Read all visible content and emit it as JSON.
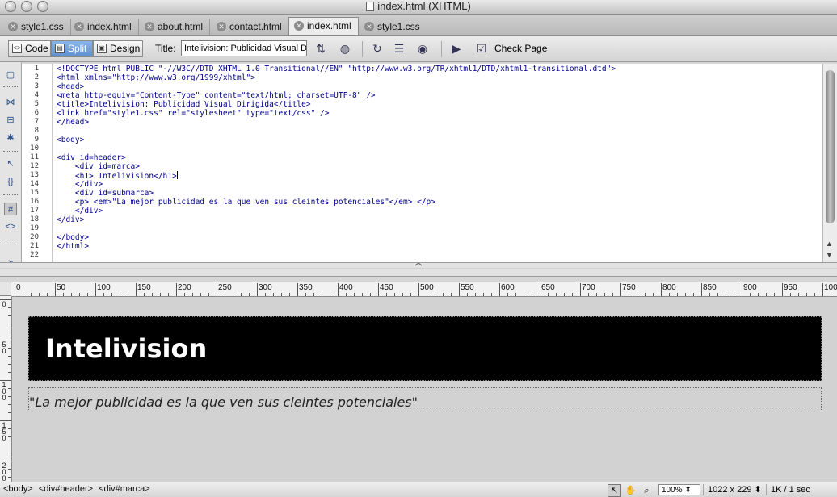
{
  "window": {
    "title": "index.html (XHTML)"
  },
  "tabs": [
    {
      "label": "style1.css"
    },
    {
      "label": "index.html"
    },
    {
      "label": "about.html"
    },
    {
      "label": "contact.html"
    },
    {
      "label": "index.html"
    },
    {
      "label": "style1.css"
    }
  ],
  "active_tab": 4,
  "toolbar": {
    "code_label": "Code",
    "split_label": "Split",
    "design_label": "Design",
    "title_label": "Title:",
    "title_value": "Intelivision: Publicidad Visual D",
    "check_page_label": "Check Page"
  },
  "code": {
    "line_numbers": [
      "1",
      "2",
      "3",
      "4",
      "5",
      "6",
      "7",
      "8",
      "9",
      "10",
      "11",
      "12",
      "13",
      "14",
      "15",
      "16",
      "17",
      "18",
      "19",
      "20",
      "21",
      "22"
    ],
    "lines": [
      "<!DOCTYPE html PUBLIC \"-//W3C//DTD XHTML 1.0 Transitional//EN\" \"http://www.w3.org/TR/xhtml1/DTD/xhtml1-transitional.dtd\">",
      "<html xmlns=\"http://www.w3.org/1999/xhtml\">",
      "<head>",
      "<meta http-equiv=\"Content-Type\" content=\"text/html; charset=UTF-8\" />",
      "<title>Intelivision: Publicidad Visual Dirigida</title>",
      "<link href=\"style1.css\" rel=\"stylesheet\" type=\"text/css\" />",
      "</head>",
      "",
      "<body>",
      "",
      "<div id=header>",
      "    <div id=marca>",
      "    <h1> Intelivision</h1>",
      "    </div>",
      "    <div id=submarca>",
      "    <p> <em>\"La mejor publicidad es la que ven sus cleintes potenciales\"</em> </p>",
      "    </div>",
      "</div>",
      "",
      "</body>",
      "</html>",
      ""
    ]
  },
  "ruler": {
    "labels": [
      "0",
      "50",
      "100",
      "150",
      "200",
      "250",
      "300",
      "350",
      "400",
      "450",
      "500",
      "550",
      "600",
      "650",
      "700",
      "750",
      "800",
      "850",
      "900",
      "950",
      "100"
    ]
  },
  "vruler": {
    "labels": [
      "0",
      "50",
      "100",
      "150",
      "200"
    ]
  },
  "design": {
    "heading": "Intelivision",
    "slogan": "\"La mejor publicidad es la que ven sus cleintes potenciales\""
  },
  "status": {
    "tag_selector": [
      "<body>",
      "<div#header>",
      "<div#marca>"
    ],
    "zoom": "100%",
    "dimensions": "1022 x 229",
    "download": "1K / 1 sec"
  },
  "icons": {
    "close": "close-icon",
    "code_view": "code-view-icon",
    "split_view": "split-view-icon",
    "design_view": "design-view-icon"
  },
  "colors": {
    "code_text": "#00008b",
    "header_bg": "#000000",
    "heading_text": "#ffffff",
    "split_active": "#6a97d6"
  }
}
